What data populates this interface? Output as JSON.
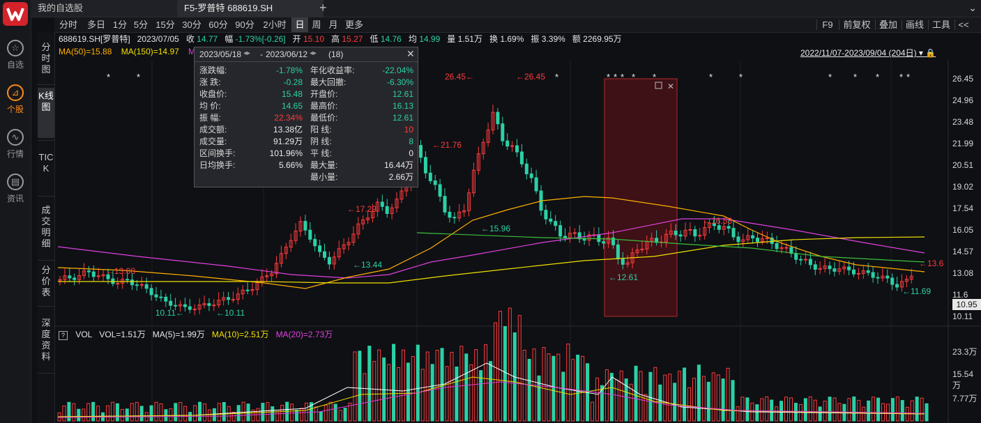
{
  "app": {
    "rail": [
      {
        "label": "自选",
        "icon": "star-icon",
        "active": false
      },
      {
        "label": "个股",
        "icon": "chart-icon",
        "active": true
      },
      {
        "label": "行情",
        "icon": "trend-icon",
        "active": false
      },
      {
        "label": "资讯",
        "icon": "news-icon",
        "active": false
      }
    ],
    "tabs": [
      "我的自选股",
      "F5-罗普特 688619.SH"
    ],
    "plus": "+"
  },
  "toolbar": {
    "periods": [
      "分时",
      "多日",
      "1分",
      "5分",
      "15分",
      "30分",
      "60分",
      "90分",
      "2小时",
      "日",
      "周",
      "月",
      "更多"
    ],
    "selected": "日",
    "right": [
      "F9",
      "前复权",
      "叠加",
      "画线",
      "工具",
      "<<"
    ]
  },
  "vtabs": [
    "分时图",
    "K线图",
    "TICK",
    "成交明细",
    "分价表",
    "深度资料"
  ],
  "info": {
    "code_name": "688619.SH[罗普特]",
    "date": "2023/07/05",
    "close_label": "收",
    "close": "14.77",
    "chg_label": "幅",
    "chg": "-1.73%[-0.26]",
    "open_label": "开",
    "open": "15.10",
    "high_label": "高",
    "high": "15.27",
    "low_label": "低",
    "low": "14.76",
    "avg_label": "均",
    "avg": "14.99",
    "vol_label": "量",
    "vol": "1.51万",
    "turn_label": "换",
    "turn": "1.69%",
    "amp_label": "振",
    "amp": "3.39%",
    "amt_label": "额",
    "amt": "2269.95万"
  },
  "ma": {
    "ma50": "MA(50)=15.88",
    "ma150": "MA(150)=14.97",
    "m_prefix": "M"
  },
  "range_label": "2022/11/07-2023/09/04 (204日)",
  "popup": {
    "from": "2023/05/18",
    "to": "2023/06/12",
    "count": "(18)",
    "left": [
      {
        "k": "涨跌幅:",
        "v": "-1.78%",
        "c": "g"
      },
      {
        "k": "涨  跌:",
        "v": "-0.28",
        "c": "g"
      },
      {
        "k": "收盘价:",
        "v": "15.48",
        "c": "g"
      },
      {
        "k": "均  价:",
        "v": "14.65",
        "c": "g"
      },
      {
        "k": "振  幅:",
        "v": "22.34%",
        "c": "r"
      },
      {
        "k": "成交额:",
        "v": "13.38亿",
        "c": "w"
      },
      {
        "k": "成交量:",
        "v": "91.29万",
        "c": "w"
      },
      {
        "k": "区间换手:",
        "v": "101.96%",
        "c": "w"
      },
      {
        "k": "日均换手:",
        "v": "5.66%",
        "c": "w"
      }
    ],
    "right": [
      {
        "k": "年化收益率:",
        "v": "-22.04%",
        "c": "g"
      },
      {
        "k": "最大回撤:",
        "v": "-6.30%",
        "c": "g"
      },
      {
        "k": "开盘价:",
        "v": "12.61",
        "c": "g"
      },
      {
        "k": "最高价:",
        "v": "16.13",
        "c": "g"
      },
      {
        "k": "最低价:",
        "v": "12.61",
        "c": "g"
      },
      {
        "k": "阳  线:",
        "v": "10",
        "c": "r"
      },
      {
        "k": "阴  线:",
        "v": "8",
        "c": "g"
      },
      {
        "k": "平  线:",
        "v": "0",
        "c": "w"
      },
      {
        "k": "最大量:",
        "v": "16.44万",
        "c": "w"
      },
      {
        "k": "最小量:",
        "v": "2.66万",
        "c": "w"
      }
    ]
  },
  "price_axis": [
    "26.45",
    "24.96",
    "23.48",
    "21.99",
    "20.51",
    "19.02",
    "17.54",
    "16.05",
    "14.57",
    "13.08",
    "11.6",
    "10.11"
  ],
  "current_price": "10.95",
  "annotations": [
    {
      "t": "26.45",
      "c": "r",
      "d": "←"
    },
    {
      "t": "26.45",
      "c": "r",
      "d": "→"
    },
    {
      "t": "21.76",
      "c": "r"
    },
    {
      "t": "17.29",
      "c": "r"
    },
    {
      "t": "16.53",
      "c": "r"
    },
    {
      "t": "13.6",
      "c": "r"
    },
    {
      "t": "13.08",
      "c": "r"
    },
    {
      "t": "15.96",
      "c": "g"
    },
    {
      "t": "13.44",
      "c": "g"
    },
    {
      "t": "12.61",
      "c": "g"
    },
    {
      "t": "11.69",
      "c": "g"
    },
    {
      "t": "10.11",
      "c": "g"
    },
    {
      "t": "10.11",
      "c": "g"
    }
  ],
  "stars": "*",
  "volume": {
    "q": "?",
    "label": "VOL",
    "vol": "VOL=1.51万",
    "ma5": "MA(5)=1.99万",
    "ma10": "MA(10)=2.51万",
    "ma20": "MA(20)=2.73万",
    "axis": [
      "23.3万",
      "15.54万",
      "7.77万"
    ]
  },
  "colors": {
    "up": "#ff3b3b",
    "down": "#2bd1a6",
    "ma50": "#ffb000",
    "ma150": "#f0e000",
    "ma_m": "#e040e0",
    "green_line": "#3cbf3c",
    "bg": "#0f1014"
  },
  "chart_data": {
    "type": "candlestick",
    "period": "日",
    "price_ylim": [
      10.11,
      26.45
    ],
    "highlight_range": [
      "2023/05/18",
      "2023/06/12"
    ],
    "close_trend": [
      12.6,
      12.7,
      12.9,
      13.1,
      12.9,
      12.6,
      12.4,
      12.5,
      12.3,
      11.9,
      11.5,
      11.0,
      10.9,
      10.6,
      10.7,
      10.8,
      11.0,
      11.2,
      11.4,
      11.7,
      12.1,
      12.6,
      13.2,
      14.2,
      15.5,
      16.4,
      15.6,
      14.3,
      13.9,
      14.5,
      15.4,
      16.2,
      17.1,
      17.7,
      17.4,
      17.9,
      19.3,
      21.6,
      20.2,
      18.9,
      17.5,
      16.6,
      17.6,
      19.9,
      22.3,
      23.9,
      22.4,
      21.6,
      20.8,
      19.4,
      17.6,
      16.4,
      15.8,
      15.6,
      15.6,
      15.5,
      15.4,
      15.3,
      14.2,
      13.6,
      14.8,
      15.1,
      15.3,
      15.6,
      15.8,
      15.9,
      15.7,
      16.1,
      16.4,
      16.2,
      15.6,
      15.3,
      15.5,
      15.4,
      15.1,
      14.8,
      14.4,
      14.0,
      13.6,
      13.4,
      13.3,
      13.4,
      13.2,
      13.1,
      13.0,
      12.8,
      12.6,
      12.2,
      12.5,
      13.4
    ]
  }
}
